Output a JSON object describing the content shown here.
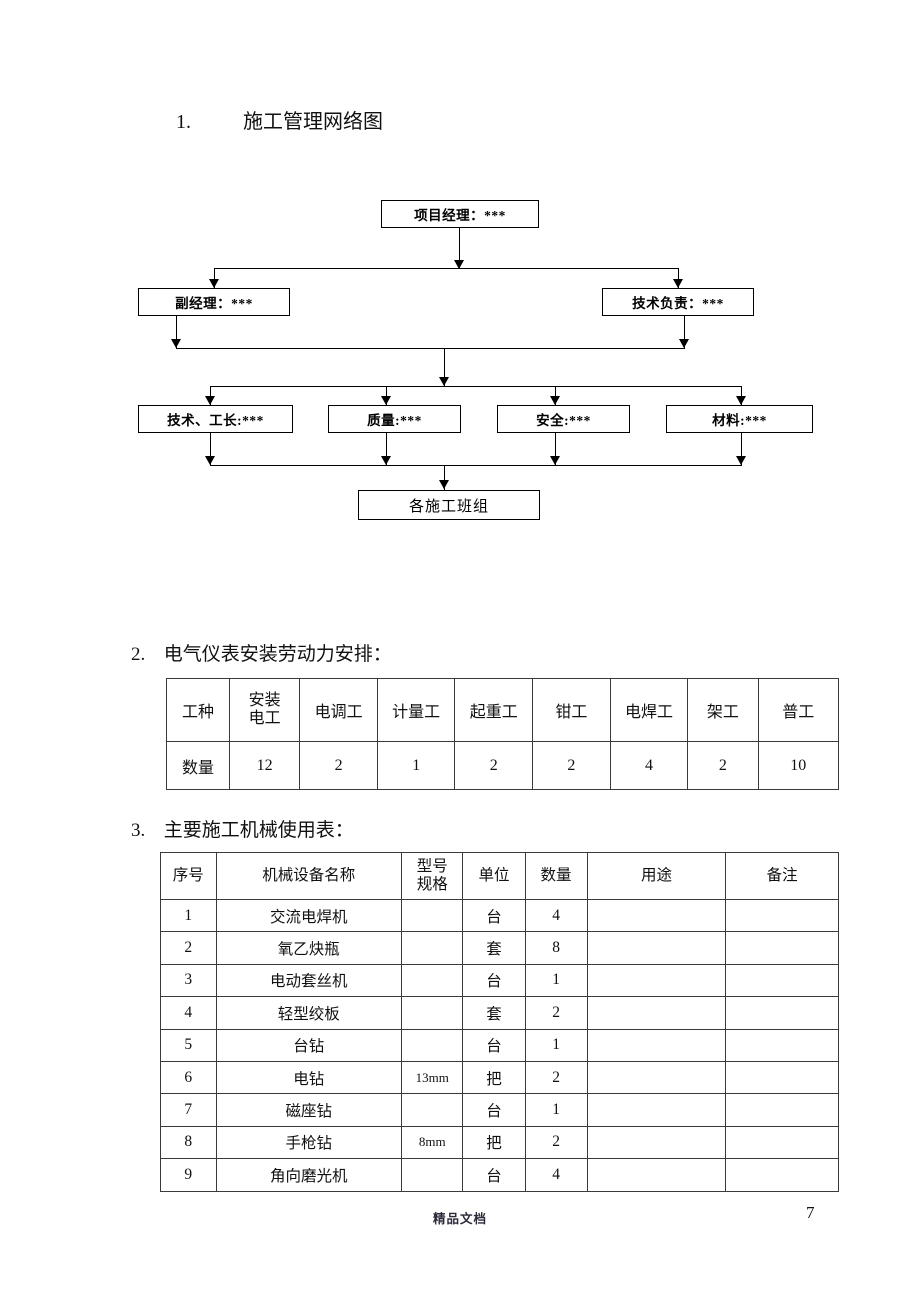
{
  "document": {
    "page_number": "7",
    "footer_note": "精品文档"
  },
  "sections": {
    "chart": {
      "number": "1.",
      "title": "施工管理网络图"
    },
    "labour": {
      "number": "2.",
      "title": "电气仪表安装劳动力安排："
    },
    "machine": {
      "number": "3.",
      "title": "主要施工机械使用表："
    }
  },
  "org_chart": {
    "level1": [
      {
        "label": "项目经理：***"
      }
    ],
    "level2": [
      {
        "label": "副经理：***"
      },
      {
        "label": "技术负责：***"
      }
    ],
    "level3": [
      {
        "label": "技术、工长:***"
      },
      {
        "label": "质量:***"
      },
      {
        "label": "安全:***"
      },
      {
        "label": "材料:***"
      }
    ],
    "level4": [
      {
        "label": "各施工班组"
      }
    ]
  },
  "labour_table": {
    "row_labels": [
      "工种",
      "数量"
    ],
    "trades": [
      "安装\n电工",
      "电调工",
      "计量工",
      "起重工",
      "钳工",
      "电焊工",
      "架工",
      "普工"
    ],
    "trades_display": {
      "t0_line1": "安装",
      "t0_line2": "电工",
      "t1": "电调工",
      "t2": "计量工",
      "t3": "起重工",
      "t4": "钳工",
      "t5": "电焊工",
      "t6": "架工",
      "t7": "普工"
    },
    "counts": [
      "12",
      "2",
      "1",
      "2",
      "2",
      "4",
      "2",
      "10"
    ]
  },
  "machine_table": {
    "headers": {
      "index": "序号",
      "name": "机械设备名称",
      "spec_line1": "型号",
      "spec_line2": "规格",
      "unit": "单位",
      "qty": "数量",
      "use": "用途",
      "remark": "备注"
    },
    "rows": [
      {
        "index": "1",
        "name": "交流电焊机",
        "spec": "",
        "unit": "台",
        "qty": "4",
        "use": "",
        "remark": ""
      },
      {
        "index": "2",
        "name": "氧乙炔瓶",
        "spec": "",
        "unit": "套",
        "qty": "8",
        "use": "",
        "remark": ""
      },
      {
        "index": "3",
        "name": "电动套丝机",
        "spec": "",
        "unit": "台",
        "qty": "1",
        "use": "",
        "remark": ""
      },
      {
        "index": "4",
        "name": "轻型绞板",
        "spec": "",
        "unit": "套",
        "qty": "2",
        "use": "",
        "remark": ""
      },
      {
        "index": "5",
        "name": "台钻",
        "spec": "",
        "unit": "台",
        "qty": "1",
        "use": "",
        "remark": ""
      },
      {
        "index": "6",
        "name": "电钻",
        "spec": "13mm",
        "unit": "把",
        "qty": "2",
        "use": "",
        "remark": ""
      },
      {
        "index": "7",
        "name": "磁座钻",
        "spec": "",
        "unit": "台",
        "qty": "1",
        "use": "",
        "remark": ""
      },
      {
        "index": "8",
        "name": "手枪钻",
        "spec": "8mm",
        "unit": "把",
        "qty": "2",
        "use": "",
        "remark": ""
      },
      {
        "index": "9",
        "name": "角向磨光机",
        "spec": "",
        "unit": "台",
        "qty": "4",
        "use": "",
        "remark": ""
      }
    ]
  },
  "colors": {
    "text": "#111111",
    "rule": "#3a3a3a",
    "page_background": "#ffffff"
  }
}
